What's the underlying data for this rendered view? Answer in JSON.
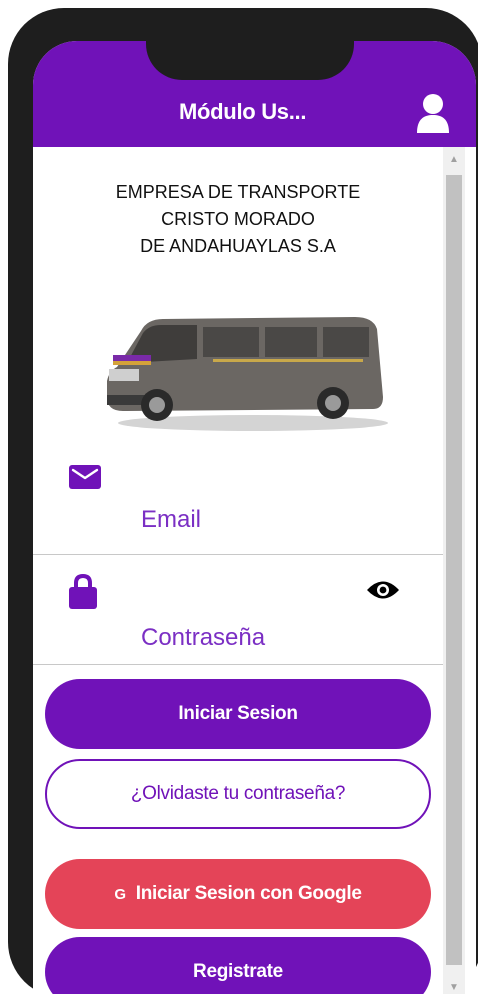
{
  "header": {
    "title": "Módulo Us...",
    "profile_icon": "user-icon"
  },
  "company": {
    "line1": "EMPRESA DE TRANSPORTE",
    "line2": "CRISTO MORADO",
    "line3": "DE ANDAHUAYLAS S.A"
  },
  "form": {
    "email": {
      "icon": "mail-icon",
      "placeholder": "Email",
      "value": ""
    },
    "password": {
      "icon": "lock-icon",
      "toggle_icon": "eye-icon",
      "placeholder": "Contraseña",
      "value": ""
    }
  },
  "buttons": {
    "login": "Iniciar Sesion",
    "forgot": "¿Olvidaste tu contraseña?",
    "google_glyph": "G",
    "google": "Iniciar Sesion con Google",
    "register": "Registrate"
  },
  "colors": {
    "primary": "#7012b8",
    "google": "#e44458",
    "frame": "#1e1e1e"
  }
}
